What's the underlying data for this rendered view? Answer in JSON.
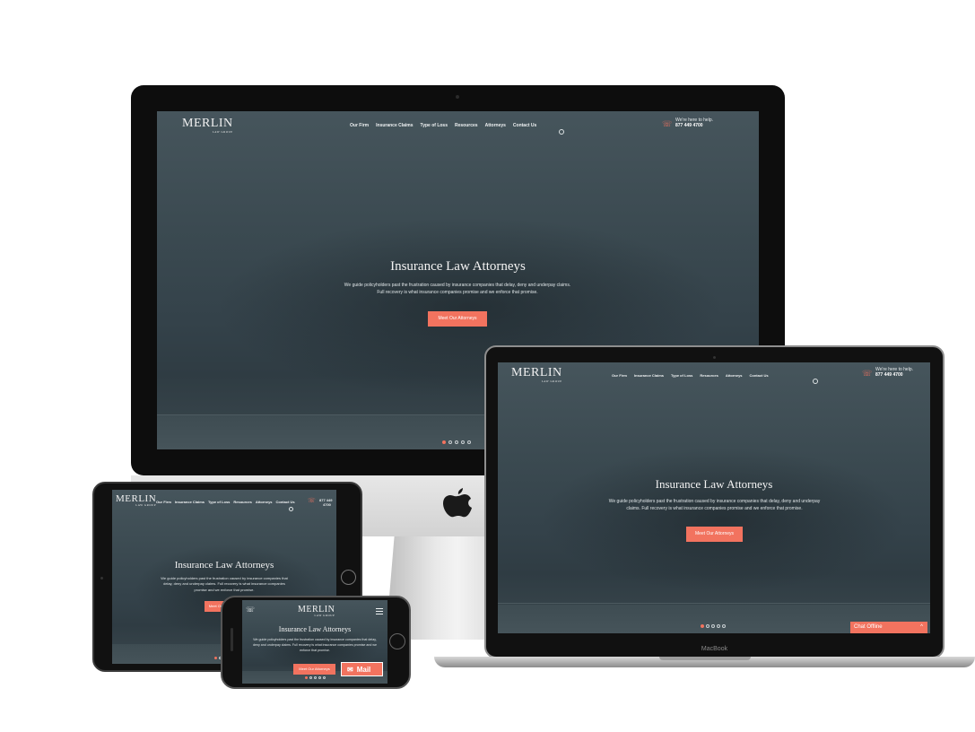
{
  "brand": {
    "name": "MERLIN",
    "tagline": "LAW GROUP"
  },
  "nav": {
    "items": [
      "Our Firm",
      "Insurance Claims",
      "Type of Loss",
      "Resources",
      "Attorneys",
      "Contact Us"
    ]
  },
  "header": {
    "help_text": "We're here to help.",
    "phone": "877 449 4700",
    "phone_wrapped": [
      "877 449",
      "4700"
    ]
  },
  "hero": {
    "title": "Insurance Law Attorneys",
    "text": "We guide policyholders past the frustration caused by insurance companies that delay, deny and underpay claims. Full recovery is what insurance companies promise and we enforce that promise.",
    "cta": "Meet Our Attorneys",
    "slides": 5,
    "active_slide": 1
  },
  "chat": {
    "label": "Chat Offline",
    "chevron": "^"
  },
  "mail": {
    "label": "Mail"
  },
  "devices": {
    "laptop_label": "MacBook",
    "apple_logo": ""
  },
  "colors": {
    "accent": "#f2735f",
    "hero_bg": "#3b4a51"
  }
}
